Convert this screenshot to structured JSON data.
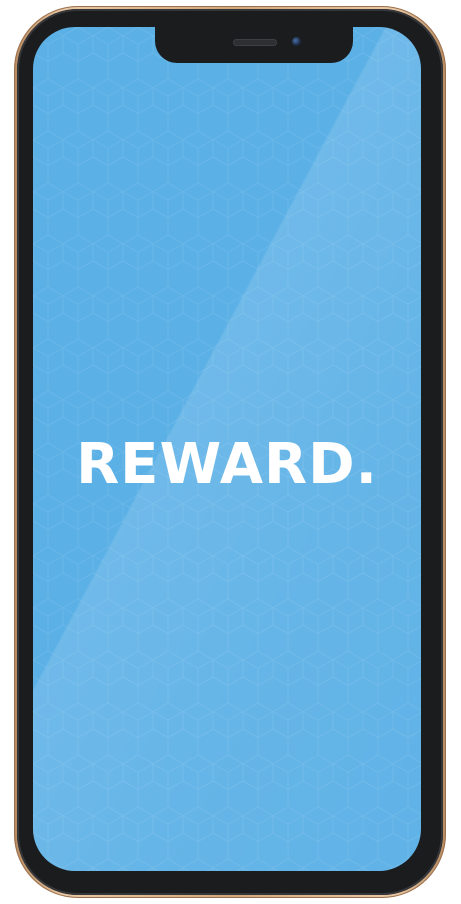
{
  "device": {
    "frame_color": "#d3a879",
    "bezel_color": "#1b1c1e"
  },
  "screen": {
    "background_color": "#5bb0e6",
    "headline": "REWARD."
  }
}
